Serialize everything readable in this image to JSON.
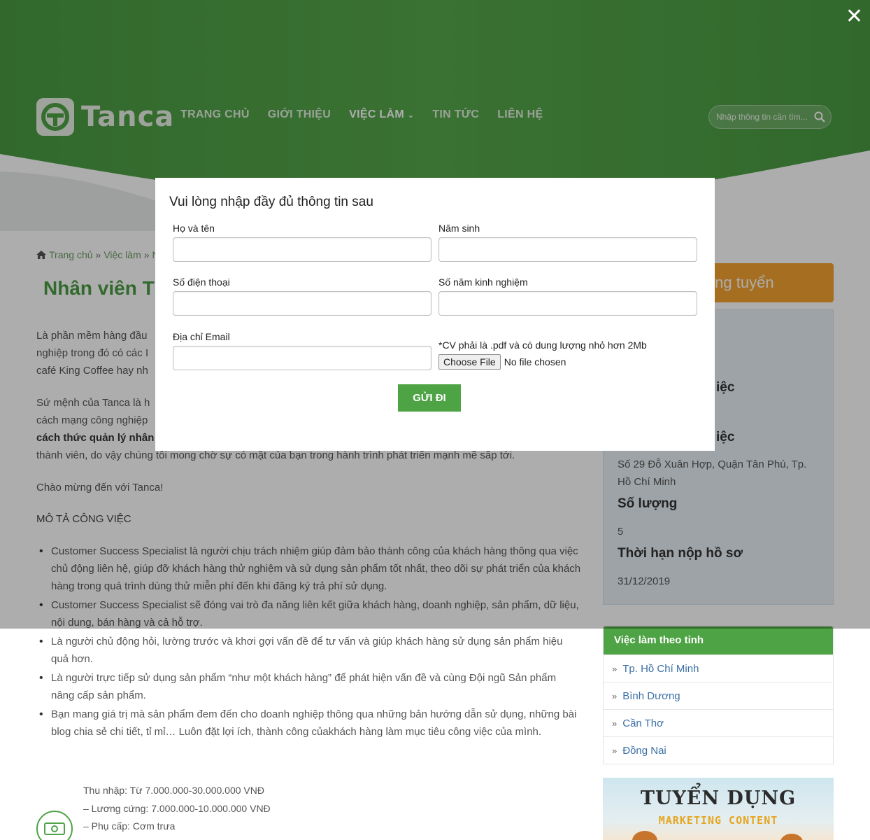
{
  "header": {
    "brand": "Tanca",
    "nav": [
      "TRANG CHỦ",
      "GIỚI THIỆU",
      "VIỆC LÀM",
      "TIN TỨC",
      "LIÊN HỆ"
    ],
    "search_placeholder": "Nhập thông tin cần tìm..."
  },
  "breadcrumb": {
    "home": "Trang chủ",
    "sep": "»",
    "jobs": "Việc làm",
    "current": "N"
  },
  "job_title": "Nhân viên T",
  "intro": {
    "p1": [
      "Là phần mềm hàng đầu",
      "nghiệp trong đó có các I",
      "café King Coffee hay nh"
    ],
    "p2": [
      "Sứ mệnh của Tanca là h",
      "cách mạng công nghiệp",
      "cách thức quản lý nhân",
      "thành viên, do vậy chúng tôi mong chờ sự có mặt của bạn trong hành trình phát triển mạnh mẽ sắp tới."
    ],
    "welcome": "Chào mừng đến với Tanca!"
  },
  "description_heading": "MÔ TẢ CÔNG VIỆC",
  "bullets": [
    "Customer Success Specialist là người chịu trách nhiệm giúp đảm bảo thành công của khách hàng thông qua việc chủ động liên hệ, giúp đỡ khách hàng thử nghiệm và sử dụng sản phẩm tốt nhất, theo dõi sự phát triển của khách hàng trong quá trình dùng thử miễn phí đến khi đăng ký trả phí sử dụng.",
    "Customer Success Specialist sẽ đóng vai trò đa năng liên kết giữa khách hàng, doanh nghiệp, sản phẩm, dữ liệu, nội dung, bán hàng và cả hỗ trợ.",
    "Là người chủ động hỏi, lường trước và khơi gợi vấn đề để tư vấn và giúp khách hàng sử dụng sản phẩm hiệu quả hơn.",
    "Là người trực tiếp sử dụng sản phẩm “như một khách hàng” để phát hiện vấn đề và cùng Đội ngũ Sản phẩm nâng cấp sản phẩm.",
    "Bạn mang giá trị mà sản phẩm đem đến cho doanh nghiệp thông qua những bản hướng dẫn sử dụng, những bài blog chia sẻ chi tiết, tỉ mỉ… Luôn đặt lợi ích, thành công củakhách hàng làm mục tiêu công việc của mình."
  ],
  "benefits": [
    "Thu nhập: Từ 7.000.000-30.000.000 VNĐ",
    "– Lương cứng: 7.000.000-10.000.000 VNĐ",
    "– Phụ cấp: Cơm trưa"
  ],
  "sidebar": {
    "apply_label": "ứng tuyển",
    "label_a": "iệc",
    "label_b": "iệc",
    "address": "Số 29 Đỗ Xuân Hợp, Quận Tân Phú, Tp. Hồ Chí Minh",
    "qty_label": "Số lượng",
    "qty_value": "5",
    "deadline_label": "Thời hạn nộp hồ sơ",
    "deadline_value": "31/12/2019",
    "province_heading": "Việc làm theo tỉnh",
    "provinces": [
      "Tp. Hồ Chí Minh",
      "Bình Dương",
      "Cần Thơ",
      "Đồng Nai"
    ],
    "banner_title": "TUYỂN DỤNG",
    "banner_sub": "MARKETING CONTENT"
  },
  "modal": {
    "title": "Vui lòng nhập đầy đủ thông tin sau",
    "name_label": "Họ và tên",
    "birth_label": "Năm sinh",
    "phone_label": "Số điện thoại",
    "exp_label": "Số năm kinh nghiệm",
    "email_label": "Địa chỉ Email",
    "cv_note": "*CV phải là .pdf và có dung lượng nhỏ hơn 2Mb",
    "choose_file": "Choose File",
    "no_file": "No file chosen",
    "submit": "GỬI ĐI"
  },
  "colors": {
    "brand_green": "#4ea345",
    "apply_orange": "#f3a230",
    "link_blue": "#3a6fa5"
  }
}
